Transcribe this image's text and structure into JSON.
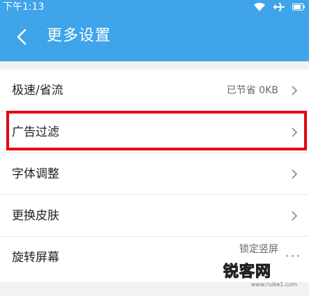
{
  "status_bar": {
    "time": "下午1:13"
  },
  "header": {
    "title": "更多设置"
  },
  "settings": [
    {
      "label": "极速/省流",
      "value": "已节省 0KB"
    },
    {
      "label": "广告过滤",
      "value": ""
    },
    {
      "label": "字体调整",
      "value": ""
    },
    {
      "label": "更换皮肤",
      "value": ""
    },
    {
      "label": "旋转屏幕",
      "value": "锁定竖屏"
    }
  ],
  "watermark": {
    "brand": "锐客网",
    "site": "www.ruike1.com"
  },
  "colors": {
    "header": "#3fa4e9",
    "highlight": "#e60012",
    "background": "#f2f2f2"
  }
}
